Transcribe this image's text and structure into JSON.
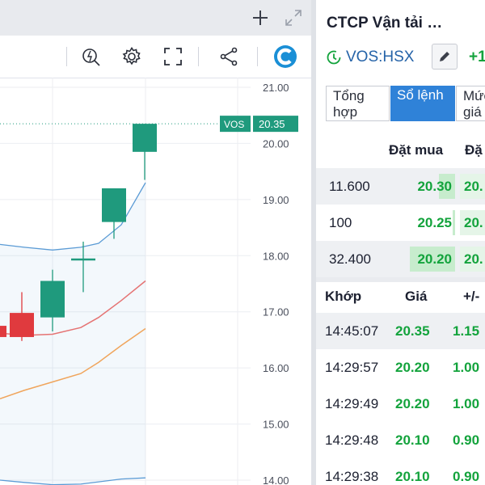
{
  "toolbar": {
    "icons": [
      "plus-icon",
      "expand-icon",
      "indicators-icon",
      "settings-icon",
      "fullscreen-icon",
      "share-icon",
      "logo-icon"
    ]
  },
  "chart_data": {
    "type": "candlestick",
    "symbol_label": "VOS",
    "last_price_label": "20.35",
    "y_ticks": [
      "21.00",
      "20.00",
      "19.00",
      "18.00",
      "17.00",
      "16.00",
      "15.00",
      "14.00"
    ],
    "ylim": [
      13.9,
      21.1
    ],
    "candles": [
      {
        "open": 16.75,
        "high": 16.9,
        "low": 16.4,
        "close": 16.55,
        "color": "#e03a3e"
      },
      {
        "open": 16.98,
        "high": 17.35,
        "low": 16.48,
        "close": 16.55,
        "color": "#e03a3e"
      },
      {
        "open": 16.9,
        "high": 17.75,
        "low": 16.65,
        "close": 17.55,
        "color": "#1f9a7d"
      },
      {
        "open": 17.92,
        "high": 18.25,
        "low": 17.35,
        "close": 17.95,
        "color": "#1f9a7d"
      },
      {
        "open": 18.6,
        "high": 19.2,
        "low": 18.3,
        "close": 19.2,
        "color": "#1f9a7d"
      },
      {
        "open": 19.85,
        "high": 20.35,
        "low": 19.35,
        "close": 20.35,
        "color": "#1f9a7d"
      }
    ],
    "bands": {
      "upper": [
        18.2,
        18.15,
        18.1,
        18.15,
        18.22,
        18.55,
        19.3
      ],
      "lower": [
        14.0,
        13.96,
        13.92,
        13.93,
        13.97,
        14.02,
        14.04
      ],
      "ma_red": [
        16.62,
        16.58,
        16.6,
        16.72,
        16.9,
        17.2,
        17.55
      ],
      "ma_orange": [
        15.45,
        15.6,
        15.75,
        15.9,
        16.1,
        16.4,
        16.7
      ]
    },
    "colors": {
      "up": "#1f9a7d",
      "down": "#e03a3e",
      "band": "#5b9bd5",
      "ma_red": "#e57373",
      "ma_orange": "#f0a55c"
    }
  },
  "quote": {
    "company_name": "CTCP Vận tải …",
    "ticker": "VOS:HSX",
    "change": "+1",
    "tabs": [
      {
        "label": "Tổng hợp",
        "active": false
      },
      {
        "label": "Sổ lệnh",
        "active": true
      },
      {
        "label": "Mức giá",
        "active": false
      }
    ]
  },
  "orderbook": {
    "headers": {
      "bid": "Đặt mua",
      "ask": "Đặ"
    },
    "rows": [
      {
        "volume": "11.600",
        "bid_price": "20.30",
        "ask": "20.",
        "fill": 0.35
      },
      {
        "volume": "100",
        "bid_price": "20.25",
        "ask": "20.",
        "fill": 0.05
      },
      {
        "volume": "32.400",
        "bid_price": "20.20",
        "ask": "20.",
        "fill": 1.0
      }
    ]
  },
  "trades": {
    "headers": {
      "time": "Khớp",
      "price": "Giá",
      "change": "+/-"
    },
    "rows": [
      {
        "time": "14:45:07",
        "price": "20.35",
        "change": "1.15"
      },
      {
        "time": "14:29:57",
        "price": "20.20",
        "change": "1.00"
      },
      {
        "time": "14:29:49",
        "price": "20.20",
        "change": "1.00"
      },
      {
        "time": "14:29:48",
        "price": "20.10",
        "change": "0.90"
      },
      {
        "time": "14:29:38",
        "price": "20.10",
        "change": "0.90"
      }
    ]
  }
}
